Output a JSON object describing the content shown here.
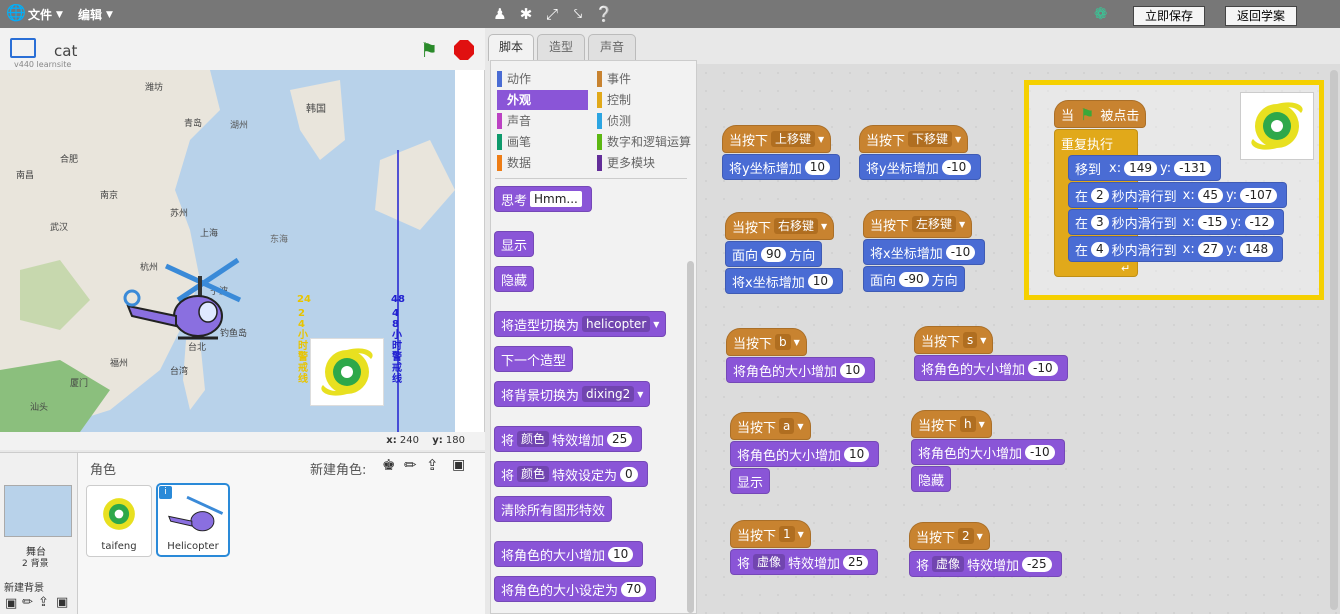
{
  "menu": {
    "file": "文件",
    "edit": "编辑",
    "save_now": "立即保存",
    "back": "返回学案"
  },
  "stage": {
    "sprite_name": "cat",
    "version": "v440 learnsite",
    "coord_x_label": "x:",
    "coord_x": "240",
    "coord_y_label": "y:",
    "coord_y": "180",
    "map_labels": [
      "潍坊",
      "青岛",
      "韩国",
      "湖州",
      "南京",
      "苏州",
      "合肥",
      "上海",
      "杭州",
      "南昌",
      "武汉",
      "东海",
      "钓鱼岛",
      "台北",
      "台湾",
      "福州",
      "厦门",
      "汕头",
      "宁波"
    ],
    "warn24": "24小时警戒线",
    "warn48": "48小时警戒线",
    "warn24_num": "24",
    "warn48_num": "48"
  },
  "sprites": {
    "header": "角色",
    "new_sprite": "新建角色:",
    "stage_label": "舞台",
    "stage_backdrops": "2 背景",
    "new_backdrop": "新建背景",
    "items": [
      {
        "name": "taifeng"
      },
      {
        "name": "Helicopter"
      }
    ]
  },
  "tabs": [
    "脚本",
    "造型",
    "声音"
  ],
  "categories": [
    {
      "label": "动作",
      "color": "#4a6cd4"
    },
    {
      "label": "事件",
      "color": "#c88330"
    },
    {
      "label": "外观",
      "color": "#8a55d7"
    },
    {
      "label": "控制",
      "color": "#e1a91a"
    },
    {
      "label": "声音",
      "color": "#bb42c3"
    },
    {
      "label": "侦测",
      "color": "#2ca5e2"
    },
    {
      "label": "画笔",
      "color": "#0e9a6c"
    },
    {
      "label": "数字和逻辑运算",
      "color": "#5cb712"
    },
    {
      "label": "数据",
      "color": "#ee7d16"
    },
    {
      "label": "更多模块",
      "color": "#632d99"
    }
  ],
  "palette": {
    "think": "思考",
    "think_val": "Hmm...",
    "show": "显示",
    "hide": "隐藏",
    "switch_costume": "将造型切换为",
    "costume_val": "helicopter",
    "next_costume": "下一个造型",
    "switch_backdrop": "将背景切换为",
    "backdrop_val": "dixing2",
    "change_effect_a": "将",
    "effect_val": "颜色",
    "change_effect_b": "特效增加",
    "change_effect_num": "25",
    "set_effect_a": "将",
    "set_effect_b": "特效设定为",
    "set_effect_num": "0",
    "clear_effects": "清除所有图形特效",
    "change_size": "将角色的大小增加",
    "change_size_num": "10",
    "set_size": "将角色的大小设定为",
    "set_size_num": "70"
  },
  "scripts": {
    "when_key": "当按下",
    "keys": {
      "up": "上移键",
      "down": "下移键",
      "right": "右移键",
      "left": "左移键",
      "b": "b",
      "s": "s",
      "a": "a",
      "h": "h",
      "one": "1",
      "two": "2"
    },
    "change_y": "将y坐标增加",
    "change_x": "将x坐标增加",
    "point_dir_a": "面向",
    "point_dir_b": "方向",
    "change_size": "将角色的大小增加",
    "show": "显示",
    "hide": "隐藏",
    "effect_a": "将",
    "effect_b": "特效增加",
    "mosaic": "虚像",
    "vals": {
      "up": "10",
      "down": "-10",
      "dir_right": "90",
      "xr": "10",
      "xl": "-10",
      "dir_left": "-90",
      "b": "10",
      "s": "-10",
      "a": "10",
      "h": "-10",
      "e1": "25",
      "e2": "-25"
    },
    "flag_when": "当",
    "flag_clicked": "被点击",
    "forever": "重复执行",
    "goto": "移到",
    "x": "x:",
    "y": "y:",
    "glide_a": "在",
    "glide_b": "秒内滑行到",
    "goto_x": "149",
    "goto_y": "-131",
    "g1_t": "2",
    "g1_x": "45",
    "g1_y": "-107",
    "g2_t": "3",
    "g2_x": "-15",
    "g2_y": "-12",
    "g3_t": "4",
    "g3_x": "27",
    "g3_y": "148"
  }
}
